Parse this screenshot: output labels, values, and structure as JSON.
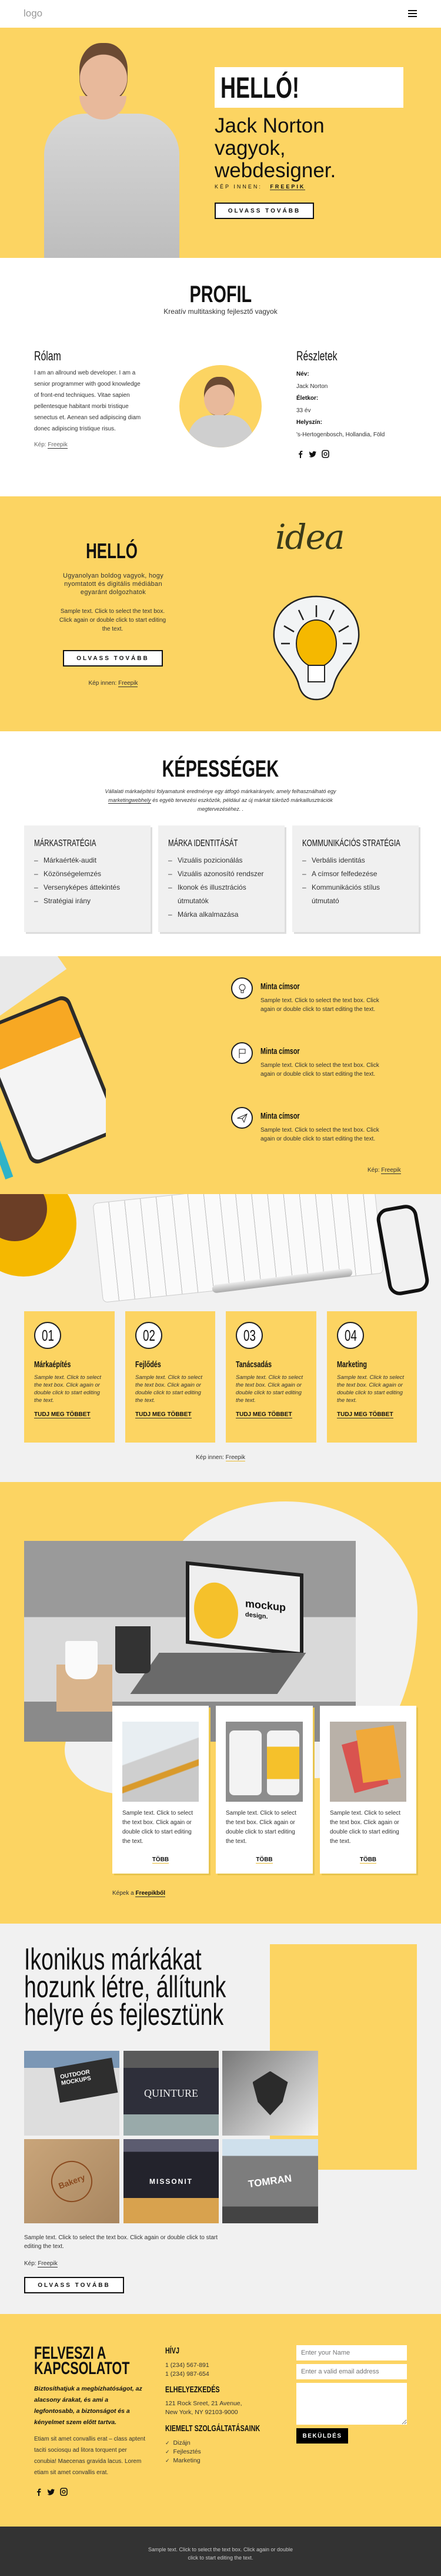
{
  "header": {
    "logo": "logo",
    "menu_icon": "hamburger-icon"
  },
  "hero": {
    "title": "HELLÓ!",
    "line1": "Jack Norton",
    "line2": "vagyok,",
    "line3": "webdesigner.",
    "credit_label": "KÉP INNEN:",
    "credit_link": "FREEPIK",
    "button": "OLVASS TOVÁBB"
  },
  "profile": {
    "title": "PROFIL",
    "subtitle": "Kreatív multitasking fejlesztő vagyok",
    "about_title": "Rólam",
    "about_text": "I am an allround web developer. I am a senior programmer with good knowledge of front-end techniques. Vitae sapien pellentesque habitant morbi tristique senectus et. Aenean sed adipiscing diam donec adipiscing tristique risus.",
    "credit_label": "Kép:",
    "credit_link": "Freepik",
    "details_title": "Részletek",
    "details": [
      {
        "label": "Név:",
        "value": "Jack Norton"
      },
      {
        "label": "Életkor:",
        "value": "33 év"
      },
      {
        "label": "Helyszín:",
        "value": "'s-Hertogenbosch, Hollandia, Föld"
      }
    ],
    "social": [
      "facebook-icon",
      "twitter-icon",
      "instagram-icon"
    ]
  },
  "hello": {
    "title": "HELLÓ",
    "subtitle": "Ugyanolyan boldog vagyok, hogy nyomtatott és digitális médiában egyaránt dolgozhatok",
    "text": "Sample text. Click to select the text box. Click again or double click to start editing the text.",
    "button": "OLVASS TOVÁBB",
    "credit_label": "Kép innen:",
    "credit_link": "Freepik",
    "idea_word": "idea"
  },
  "skills": {
    "title": "KÉPESSÉGEK",
    "intro_1": "Vállalati márkaépítési folyamatunk eredménye egy átfogó márkairányelv, amely felhasználható egy",
    "intro_link": "marketingwebhely",
    "intro_2": "és egyéb tervezési eszközök, például az új márkát tükröző márkaillusztrációk megtervezéséhez. .",
    "cards": [
      {
        "title": "MÁRKASTRATÉGIA",
        "items": [
          "Márkaérték-audit",
          "Közönségelemzés",
          "Versenyképes áttekintés",
          "Stratégiai irány"
        ]
      },
      {
        "title": "MÁRKA IDENTITÁSÁT",
        "items": [
          "Vizuális pozicionálás",
          "Vizuális azonosító rendszer",
          "Ikonok és illusztrációs útmutatók",
          "Márka alkalmazása"
        ]
      },
      {
        "title": "KOMMUNIKÁCIÓS STRATÉGIA",
        "items": [
          "Verbális identitás",
          "A címsor felfedezése",
          "Kommunikációs stílus útmutató"
        ]
      }
    ]
  },
  "features": {
    "items": [
      {
        "icon": "lightbulb-icon",
        "title": "Minta címsor",
        "text": "Sample text. Click to select the text box. Click again or double click to start editing the text."
      },
      {
        "icon": "flag-icon",
        "title": "Minta címsor",
        "text": "Sample text. Click to select the text box. Click again or double click to start editing the text."
      },
      {
        "icon": "paper-plane-icon",
        "title": "Minta címsor",
        "text": "Sample text. Click to select the text box. Click again or double click to start editing the text."
      }
    ],
    "credit_label": "Kép:",
    "credit_link": "Freepik"
  },
  "services": {
    "items": [
      {
        "num": "01",
        "title": "Márkaépítés",
        "text": "Sample text.  Click to select the text box. Click again or double click to start editing the text.",
        "link": "TUDJ MEG TÖBBET"
      },
      {
        "num": "02",
        "title": "Fejlődés",
        "text": "Sample text. Click to select the text box. Click again or double click to start editing the text.",
        "link": "TUDJ MEG TÖBBET"
      },
      {
        "num": "03",
        "title": "Tanácsadás",
        "text": "Sample text.  Click to select the text box. Click again or double click to start editing the text.",
        "link": "TUDJ MEG TÖBBET"
      },
      {
        "num": "04",
        "title": "Marketing",
        "text": "Sample text. Click to select the text box. Click again or double click to start editing the text.",
        "link": "TUDJ MEG TÖBBET"
      }
    ],
    "credit_label": "Kép innen:",
    "credit_link": "Freepik"
  },
  "mockups": {
    "laptop_screen_title": "mockup",
    "laptop_screen_sub": "design.",
    "cards": [
      {
        "text": "Sample text. Click to select the text box. Click again or double click to start editing the text.",
        "link": "TÖBB"
      },
      {
        "text": "Sample text. Click to select the text box. Click again or double click to start editing the text.",
        "link": "TÖBB"
      },
      {
        "text": "Sample text. Click to select the text box. Click again or double click to start editing the text.",
        "link": "TÖBB"
      }
    ],
    "credit_label": "Képek a",
    "credit_link": "Freepikből"
  },
  "brands": {
    "title_1": "Ikonikus márkákat",
    "title_2": "hozunk létre, állítunk",
    "title_3": "helyre és fejlesztünk",
    "gallery": [
      "OUTDOOR MOCKUPS",
      "QUINTURE",
      "",
      "Bakery",
      "MISSONIT",
      "TOMRAN"
    ],
    "text": "Sample text. Click to select the text box. Click again or double click to start editing the text.",
    "credit_label": "Kép:",
    "credit_link": "Freepik",
    "button": "OLVASS TOVÁBB"
  },
  "contact": {
    "title_1": "FELVESZI A",
    "title_2": "KAPCSOLATOT",
    "lead": "Biztosíthatjuk a megbízhatóságot, az alacsony árakat, és ami a legfontosabb, a biztonságot és a kényelmet szem előtt tartva.",
    "text": "Etiam sit amet convallis erat – class aptent taciti sociosqu ad litora torquent per conubia! Maecenas gravida lacus. Lorem etiam sit amet convallis erat.",
    "call_title": "HÍVJ",
    "phone_1": "1 (234) 567-891",
    "phone_2": "1 (234) 987-654",
    "location_title": "ELHELYEZKEDÉS",
    "address_1": "121 Rock Sreet, 21 Avenue,",
    "address_2": "New York, NY 92103-9000",
    "services_title": "KIEMELT SZOLGÁLTATÁSAINK",
    "services": [
      "Dizájn",
      "Fejlesztés",
      "Marketing"
    ],
    "form": {
      "name_placeholder": "Enter your Name",
      "email_placeholder": "Enter a valid email address",
      "message_value": "",
      "submit": "BEKÜLDÉS"
    }
  },
  "footer": {
    "text": "Sample text. Click to select the text box. Click again or double click to start editing the text."
  },
  "colors": {
    "accent": "#fcd462",
    "dark": "#333333",
    "light": "#f1f1f1"
  }
}
